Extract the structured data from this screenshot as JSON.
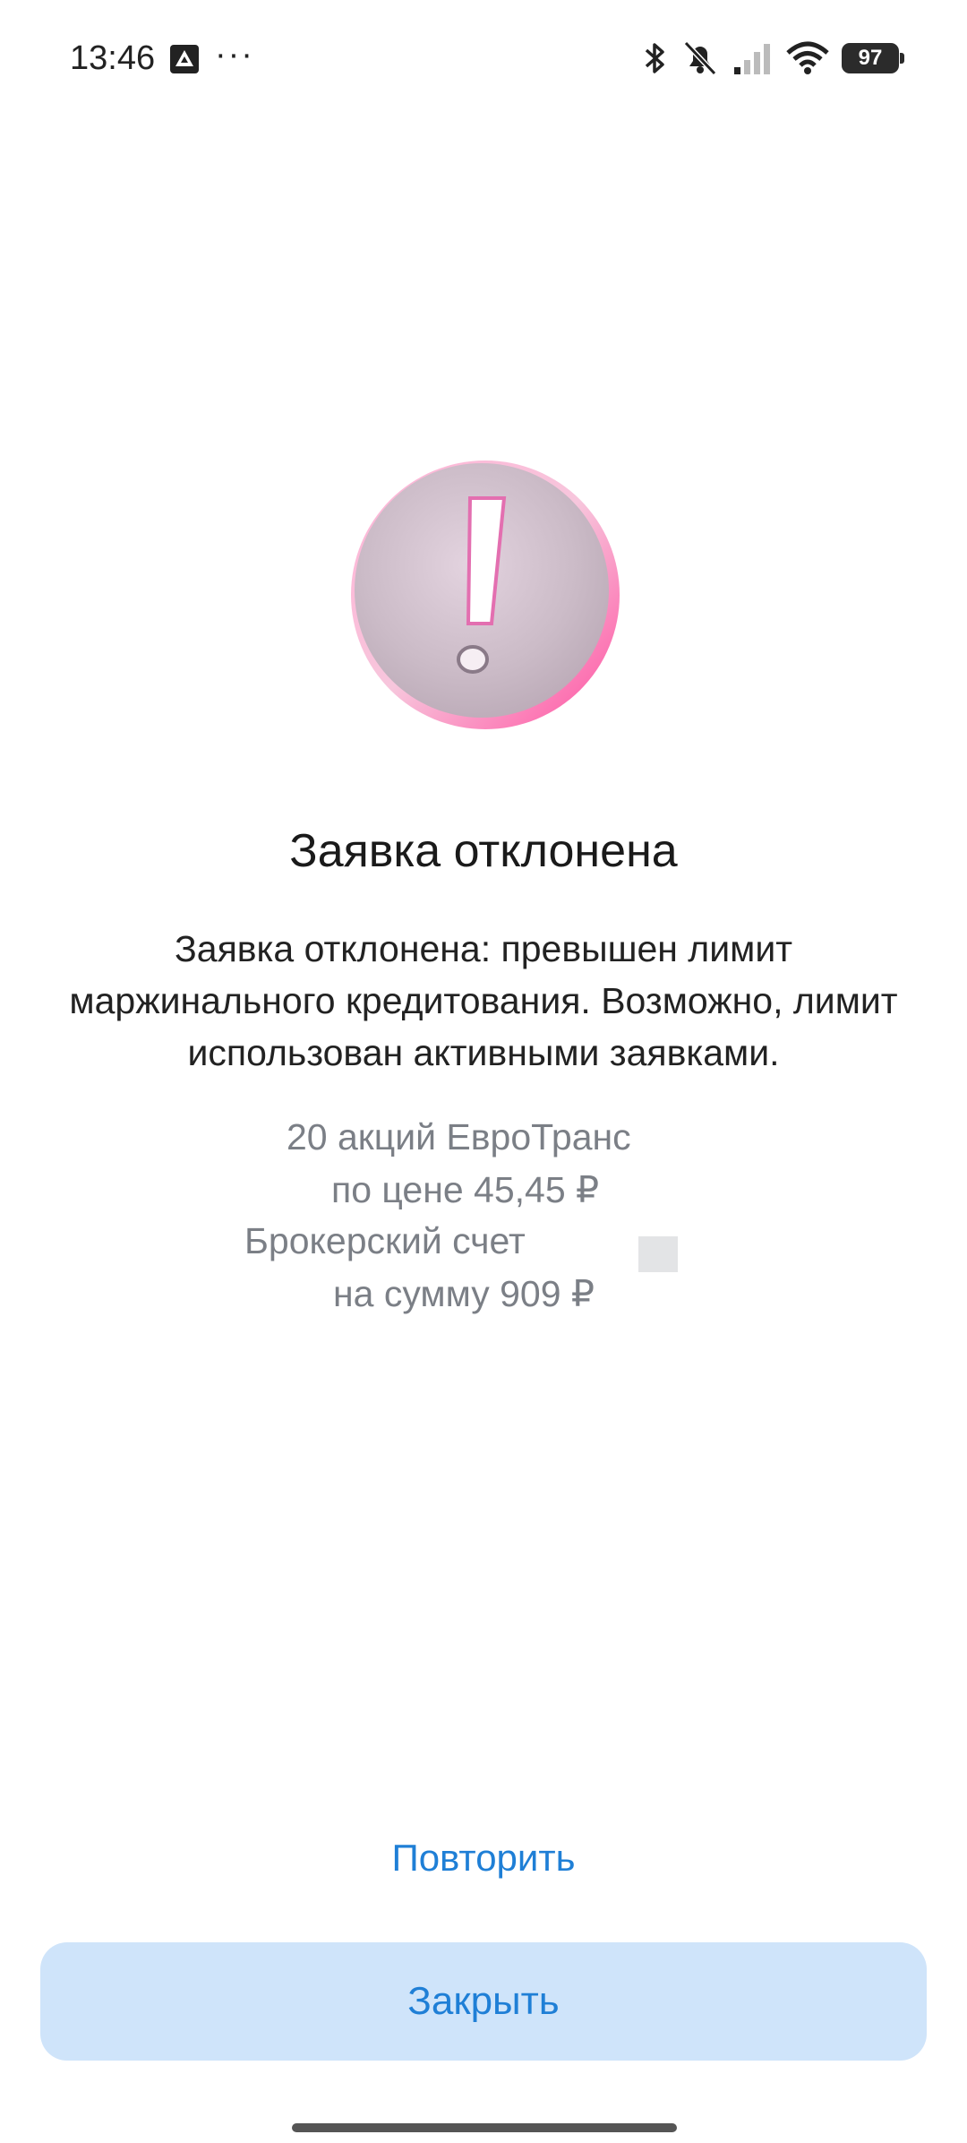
{
  "status": {
    "time": "13:46",
    "more": "···",
    "battery": "97"
  },
  "screen": {
    "title": "Заявка отклонена",
    "message": "Заявка отклонена: превышен лимит маржинального кредитования. Возможно, лимит использован активными заявками.",
    "details": {
      "line1": "20 акций ЕвроТранс",
      "line2": "по цене 45,45 ₽",
      "line3": "Брокерский счет",
      "line4": "на сумму 909 ₽"
    }
  },
  "actions": {
    "retry": "Повторить",
    "close": "Закрыть"
  },
  "colors": {
    "accent": "#1f7fd6",
    "button_bg": "#cfe4fa",
    "muted_text": "#7b7f86"
  }
}
